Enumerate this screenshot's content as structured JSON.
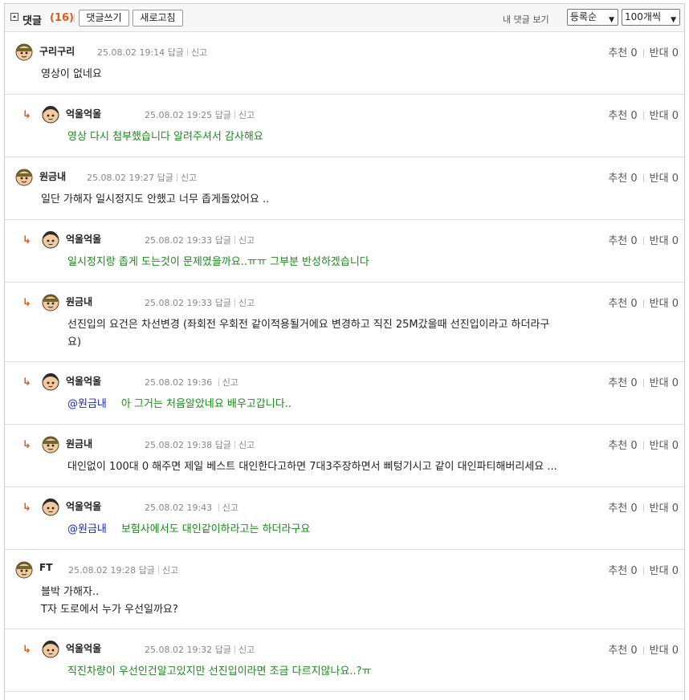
{
  "header": {
    "title": "댓글",
    "count": "(16)",
    "write_button": "댓글쓰기",
    "refresh_button": "새로고침",
    "my_comments_link": "내 댓글 보기",
    "sort_select": "등록순",
    "per_page_select": "100개씩"
  },
  "comments": [
    {
      "nick": "구리구리",
      "date": "25.08.02 19:14",
      "reply_label": "답글",
      "report_label": "신고",
      "up_label": "추천",
      "up": "0",
      "down_label": "반대",
      "down": "0",
      "mention": "",
      "text": "영상이 없네요",
      "text2": "",
      "is_reply": false,
      "green": false
    },
    {
      "nick": "억울억울",
      "date": "25.08.02 19:25",
      "reply_label": "답글",
      "report_label": "신고",
      "up_label": "추천",
      "up": "0",
      "down_label": "반대",
      "down": "0",
      "mention": "",
      "text": "영상 다시 첨부했습니다 알려주셔서 감사해요",
      "text2": "",
      "is_reply": true,
      "green": true
    },
    {
      "nick": "원금내",
      "date": "25.08.02 19:27",
      "reply_label": "답글",
      "report_label": "신고",
      "up_label": "추천",
      "up": "0",
      "down_label": "반대",
      "down": "0",
      "mention": "",
      "text": "일단 가해자 일시정지도 안했고 너무 좁게돌았어요 ..",
      "text2": "",
      "is_reply": false,
      "green": false
    },
    {
      "nick": "억울억울",
      "date": "25.08.02 19:33",
      "reply_label": "답글",
      "report_label": "신고",
      "up_label": "추천",
      "up": "0",
      "down_label": "반대",
      "down": "0",
      "mention": "",
      "text": "일시정지랑 좁게 도는것이 문제였을까요..ㅠㅠ 그부분 반성하겠습니다",
      "text2": "",
      "is_reply": true,
      "green": true
    },
    {
      "nick": "원금내",
      "date": "25.08.02 19:33",
      "reply_label": "답글",
      "report_label": "신고",
      "up_label": "추천",
      "up": "0",
      "down_label": "반대",
      "down": "0",
      "mention": "",
      "text": "선진입의 요건은 차선변경 (좌회전 우회전 같이적용될거에요 변경하고 직진 25M갔을때 선진입이라고 하더라구",
      "text2": "요)",
      "is_reply": true,
      "green": false
    },
    {
      "nick": "억울억울",
      "date": "25.08.02 19:36",
      "reply_label": "",
      "report_label": "신고",
      "up_label": "추천",
      "up": "0",
      "down_label": "반대",
      "down": "0",
      "mention": "@원금내",
      "text": "아 그거는 처음알았네요 배우고갑니다..",
      "text2": "",
      "is_reply": true,
      "green": true
    },
    {
      "nick": "원금내",
      "date": "25.08.02 19:38",
      "reply_label": "답글",
      "report_label": "신고",
      "up_label": "추천",
      "up": "0",
      "down_label": "반대",
      "down": "0",
      "mention": "",
      "text": "대인없이 100대 0 해주면 제일 베스트 대인한다고하면 7대3주장하면서 삐텅기시고 같이 대인파티해버리세요 ...",
      "text2": "",
      "is_reply": true,
      "green": false
    },
    {
      "nick": "억울억울",
      "date": "25.08.02 19:43",
      "reply_label": "",
      "report_label": "신고",
      "up_label": "추천",
      "up": "0",
      "down_label": "반대",
      "down": "0",
      "mention": "@원금내",
      "text": "보험사에서도 대인같이하라고는 하더라구요",
      "text2": "",
      "is_reply": true,
      "green": true
    },
    {
      "nick": "FT",
      "date": "25.08.02 19:28",
      "reply_label": "답글",
      "report_label": "신고",
      "up_label": "추천",
      "up": "0",
      "down_label": "반대",
      "down": "0",
      "mention": "",
      "text": "블박 가해자..",
      "text2": "T자 도로에서 누가 우선일까요?",
      "is_reply": false,
      "green": false
    },
    {
      "nick": "억울억울",
      "date": "25.08.02 19:32",
      "reply_label": "답글",
      "report_label": "신고",
      "up_label": "추천",
      "up": "0",
      "down_label": "반대",
      "down": "0",
      "mention": "",
      "text": "직진차량이 우선인건알고있지만 선진입이라면 조금 다르지않나요..?ㅠ",
      "text2": "",
      "is_reply": true,
      "green": true
    }
  ]
}
